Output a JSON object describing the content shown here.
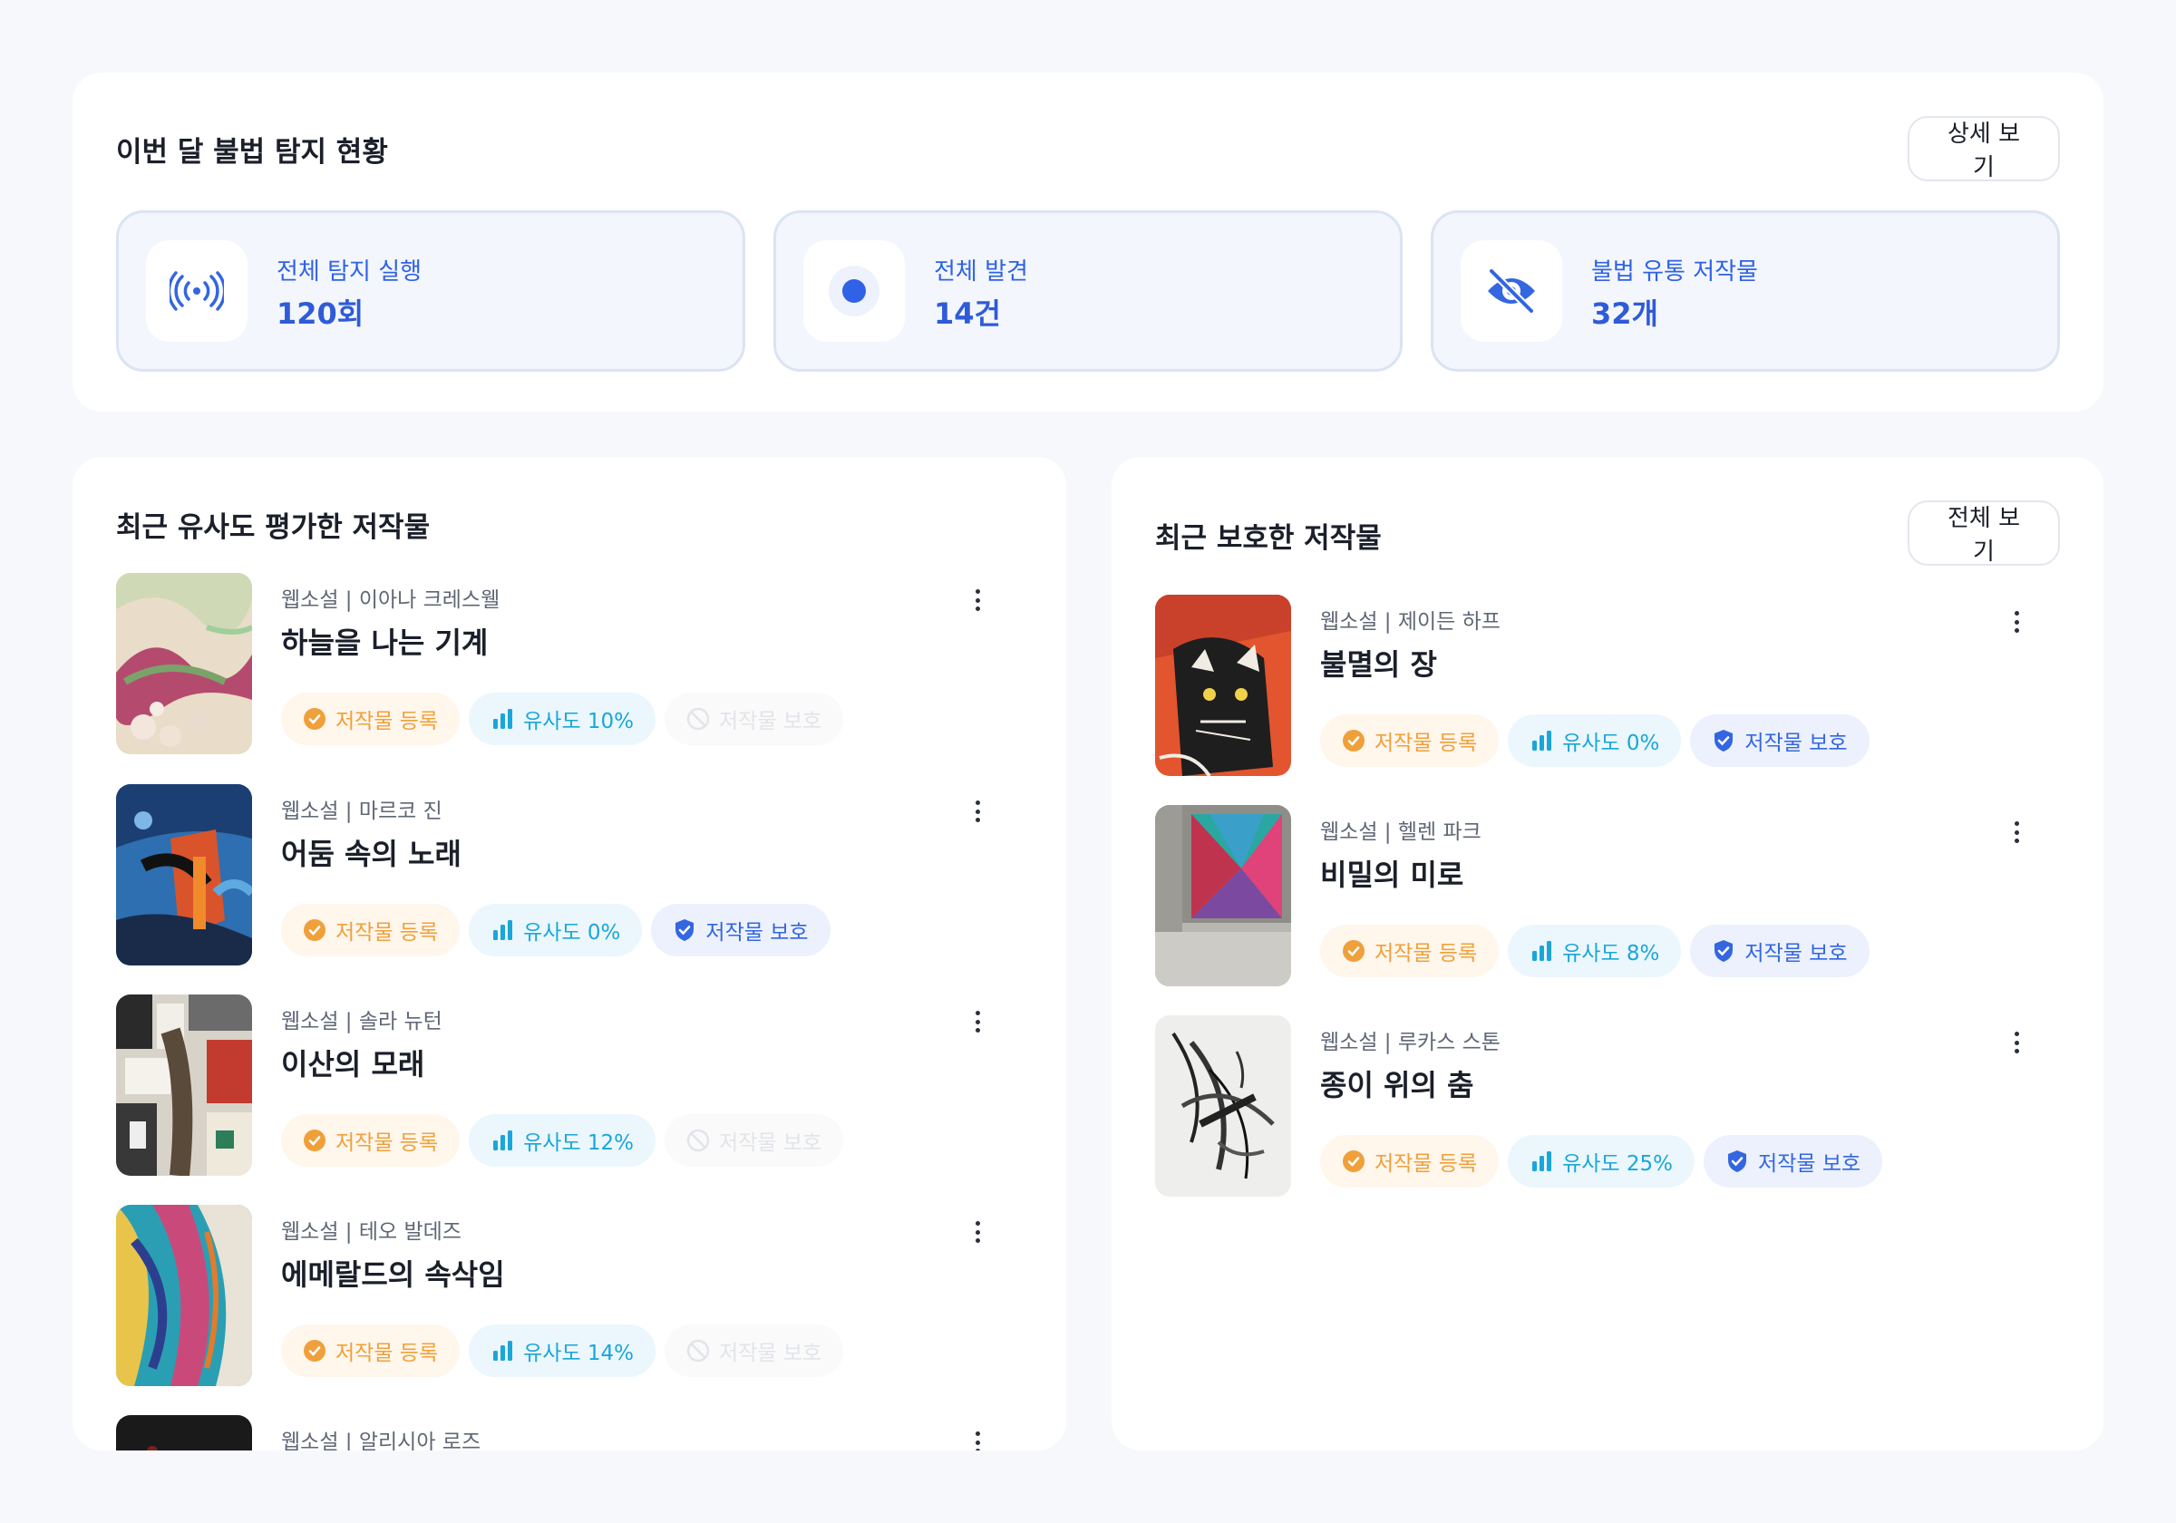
{
  "summary": {
    "title": "이번 달 불법 탐지 현황",
    "detail_button": "상세 보기",
    "stats": [
      {
        "label": "전체 탐지 실행",
        "value": "120회",
        "icon": "broadcast-icon"
      },
      {
        "label": "전체 발견",
        "value": "14건",
        "icon": "record-dot-icon"
      },
      {
        "label": "불법 유통 저작물",
        "value": "32개",
        "icon": "eye-off-icon"
      }
    ]
  },
  "recent_evaluated": {
    "title": "최근 유사도 평가한 저작물",
    "items": [
      {
        "category": "웹소설",
        "author": "이아나 크레스웰",
        "title": "하늘을 나는 기계",
        "reg": "저작물 등록",
        "similarity": "유사도 10%",
        "protect": "저작물 보호",
        "protected": false
      },
      {
        "category": "웹소설",
        "author": "마르코 진",
        "title": "어둠 속의 노래",
        "reg": "저작물 등록",
        "similarity": "유사도 0%",
        "protect": "저작물 보호",
        "protected": true
      },
      {
        "category": "웹소설",
        "author": "솔라 뉴턴",
        "title": "이산의 모래",
        "reg": "저작물 등록",
        "similarity": "유사도 12%",
        "protect": "저작물 보호",
        "protected": false
      },
      {
        "category": "웹소설",
        "author": "테오 발데즈",
        "title": "에메랄드의 속삭임",
        "reg": "저작물 등록",
        "similarity": "유사도 14%",
        "protect": "저작물 보호",
        "protected": false
      },
      {
        "category": "웹소설",
        "author": "알리시아 로즈",
        "title": "",
        "reg": "",
        "similarity": "",
        "protect": "",
        "protected": false
      }
    ]
  },
  "recent_protected": {
    "title": "최근 보호한 저작물",
    "all_button": "전체 보기",
    "items": [
      {
        "category": "웹소설",
        "author": "제이든 하프",
        "title": "불멸의 장",
        "reg": "저작물 등록",
        "similarity": "유사도 0%",
        "protect": "저작물 보호",
        "protected": true
      },
      {
        "category": "웹소설",
        "author": "헬렌 파크",
        "title": "비밀의 미로",
        "reg": "저작물 등록",
        "similarity": "유사도 8%",
        "protect": "저작물 보호",
        "protected": true
      },
      {
        "category": "웹소설",
        "author": "루카스 스톤",
        "title": "종이 위의 춤",
        "reg": "저작물 등록",
        "similarity": "유사도 25%",
        "protect": "저작물 보호",
        "protected": true
      }
    ]
  },
  "colors": {
    "accent": "#2f62e6",
    "registered": "#f0a03a",
    "similarity": "#1aa6d9",
    "protected": "#3366e0"
  }
}
